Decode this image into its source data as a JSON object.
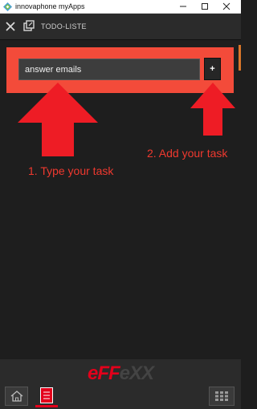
{
  "window": {
    "title": "innovaphone myApps",
    "controls": {
      "minimize_icon": "minimize-icon",
      "maximize_icon": "maximize-icon",
      "close_icon": "close-icon"
    }
  },
  "appbar": {
    "title": "TODO-LISTE",
    "close_icon": "close-icon",
    "popout_icon": "popout-icon"
  },
  "task_form": {
    "input_value": "answer emails",
    "add_label": "+"
  },
  "annotations": {
    "step1": "1. Type your task",
    "step2": "2. Add your task"
  },
  "footer": {
    "brand_part1": "eFF",
    "brand_part2": "eXX",
    "home_icon": "home-icon",
    "todo_icon": "todo-app-icon",
    "apps_icon": "apps-grid-icon"
  },
  "colors": {
    "highlight": "#f34b3a",
    "annotation": "#f0392f",
    "brand_red": "#e3001b",
    "background": "#1e1e1e"
  }
}
